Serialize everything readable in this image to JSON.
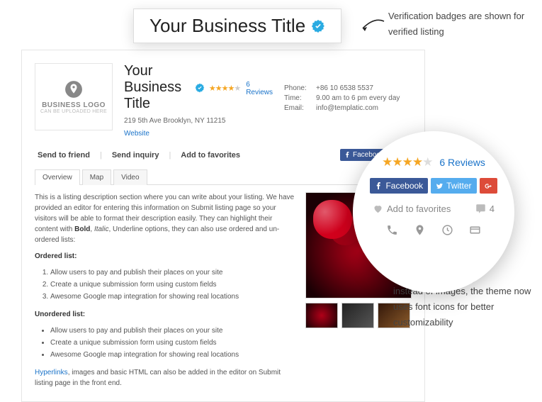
{
  "title_callout": "Your Business Title",
  "annotation1": "Verification badges are shown for verified listing",
  "annotation2": "instead of images, the theme now uses font icons for better customizability",
  "listing": {
    "title": "Your Business Title",
    "logo_line1": "BUSINESS LOGO",
    "logo_line2": "CAN BE UPLOADED HERE",
    "address": "219 5th Ave Brooklyn, NY 11215",
    "website_label": "Website",
    "reviews_label": "6 Reviews",
    "info": {
      "phone_k": "Phone:",
      "phone_v": "+86 10 6538 5537",
      "time_k": "Time:",
      "time_v": "9.00 am to 6 pm every day",
      "email_k": "Email:",
      "email_v": "info@templatic.com"
    },
    "actions": {
      "send_friend": "Send to friend",
      "send_inquiry": "Send inquiry",
      "add_favorites": "Add to favorites"
    },
    "social": {
      "facebook": "Facebook",
      "twitter": "T"
    },
    "tabs": {
      "overview": "Overview",
      "map": "Map",
      "video": "Video"
    },
    "desc": {
      "intro": "This is a listing description section where you can write about your listing. We have provided an editor for entering this information on Submit listing page so your visitors will be able to format their description easily. They can highlight their content with ",
      "bold": "Bold",
      "sep1": ", ",
      "italic": "Italic",
      "rest": ", Underline options, they can also use ordered and un-ordered lists:",
      "ordered_h": "Ordered list:",
      "ol1": "Allow users to pay and publish their places on your site",
      "ol2": "Create a unique submission form using custom fields",
      "ol3": "Awesome Google map integration for showing real locations",
      "unordered_h": "Unordered list:",
      "ul1": "Allow users to pay and publish their places on your site",
      "ul2": "Create a unique submission form using custom fields",
      "ul3": "Awesome Google map integration for showing real locations",
      "hyper": "Hyperlinks",
      "outro": ", images and basic HTML can also be added in the editor on Submit listing page in the front end."
    }
  },
  "zoom": {
    "reviews": "6 Reviews",
    "facebook": "Facebook",
    "twitter": "Twitter",
    "add_fav": "Add to favorites",
    "comments": "4"
  }
}
